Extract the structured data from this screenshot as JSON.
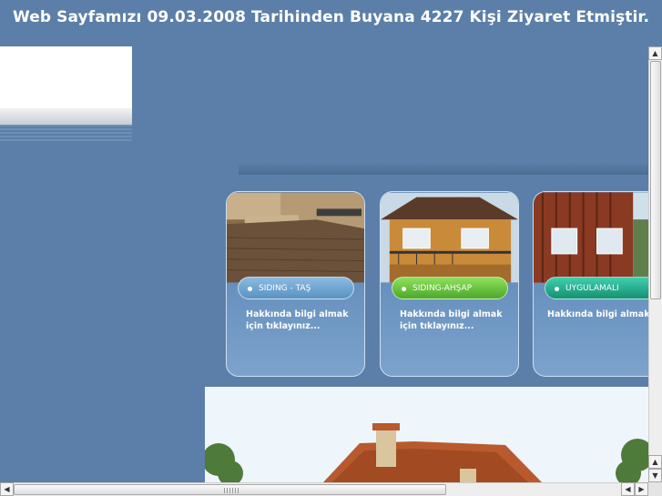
{
  "header": {
    "visitor_text": "Web Sayfamızı 09.03.2008 Tarihinden Buyana 4227 Kişi Ziyaret Etmiştir."
  },
  "cards": [
    {
      "label": "SIDING - TAŞ",
      "description": "Hakkında bilgi almak için tıklayınız...",
      "pill_color": "#6aa3d0"
    },
    {
      "label": "SIDING-AHŞAP",
      "description": "Hakkında bilgi almak için tıklayınız...",
      "pill_color": "#6cc93c"
    },
    {
      "label": "UYGULAMALI",
      "description": "Hakkında bilgi almak için tıklayınız...",
      "pill_color": "#1fae8e"
    }
  ],
  "scrollbars": {
    "up_arrow": "▲",
    "down_arrow": "▼",
    "left_arrow": "◀",
    "right_arrow": "▶"
  }
}
